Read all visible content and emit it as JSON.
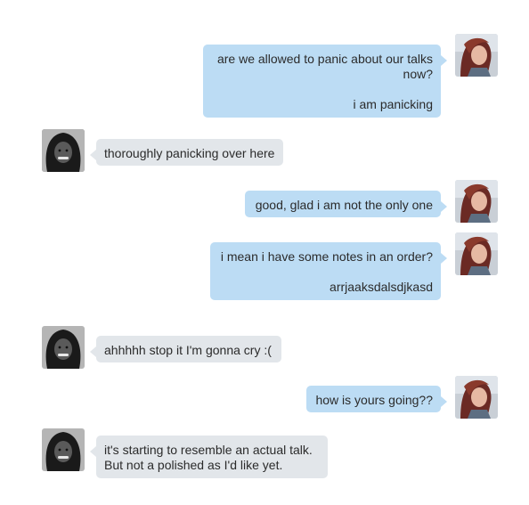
{
  "conversation": {
    "messages": [
      {
        "sender": "self",
        "lines": [
          "are we allowed to panic about our talks",
          "now?",
          "",
          "i am panicking"
        ]
      },
      {
        "sender": "other",
        "lines": [
          "thoroughly panicking over here"
        ]
      },
      {
        "sender": "self",
        "lines": [
          "good, glad i am not the only one"
        ]
      },
      {
        "sender": "self",
        "lines": [
          "i mean i have some notes in an order?",
          "",
          "arrjaaksdalsdjkasd"
        ]
      },
      {
        "sender": "other",
        "lines": [
          "ahhhhh stop it I'm gonna cry :("
        ]
      },
      {
        "sender": "self",
        "lines": [
          "how is yours going??"
        ]
      },
      {
        "sender": "other",
        "lines": [
          "it's starting to resemble an actual talk.",
          "But not a polished as I'd like yet."
        ]
      }
    ]
  },
  "colors": {
    "self_bubble": "#bcdcf4",
    "other_bubble": "#e2e6ea",
    "text": "#2b2b2b"
  },
  "avatars": {
    "self": "self-avatar-photo",
    "other": "other-avatar-photo"
  }
}
